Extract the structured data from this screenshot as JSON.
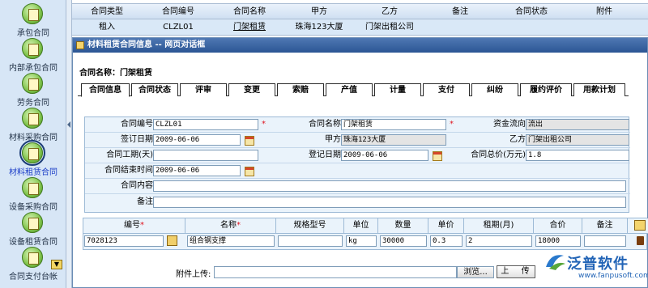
{
  "sidebar": {
    "items": [
      {
        "label": "承包合同"
      },
      {
        "label": "内部承包合同"
      },
      {
        "label": "劳务合同"
      },
      {
        "label": "材料采购合同"
      },
      {
        "label": "材料租赁合同"
      },
      {
        "label": "设备采购合同"
      },
      {
        "label": "设备租赁合同"
      },
      {
        "label": "合同支付台帐"
      }
    ],
    "active_index": 4
  },
  "list": {
    "columns": [
      "合同类型",
      "合同编号",
      "合同名称",
      "甲方",
      "乙方",
      "备注",
      "合同状态",
      "附件"
    ],
    "rows": [
      {
        "type": "租入",
        "number": "CLZL01",
        "name": "门架租赁",
        "party_a": "珠海123大厦",
        "party_b": "门架出租公司",
        "remark": "",
        "status": "",
        "attachment": ""
      }
    ]
  },
  "dialog": {
    "title": "材料租赁合同信息 -- 网页对话框",
    "contract_name_line": "合同名称：门架租赁",
    "tabs": [
      "合同信息",
      "合同状态",
      "评审",
      "变更",
      "索赔",
      "产值",
      "计量",
      "支付",
      "纠纷",
      "履约评价",
      "用款计划"
    ],
    "active_tab": 0,
    "form": {
      "contract_no_label": "合同编号",
      "contract_no": "CLZL01",
      "contract_name_label": "合同名称",
      "contract_name": "门架租赁",
      "fund_flow_label": "资金流向",
      "fund_flow": "流出",
      "sign_date_label": "签订日期",
      "sign_date": "2009-06-06",
      "party_a_label": "甲方",
      "party_a": "珠海123大厦",
      "party_b_label": "乙方",
      "party_b": "门架出租公司",
      "duration_label": "合同工期(天)",
      "duration": "",
      "register_date_label": "登记日期",
      "register_date": "2009-06-06",
      "total_price_label": "合同总价(万元)",
      "total_price": "1.8",
      "end_date_label": "合同结束时间",
      "end_date": "2009-06-06",
      "content_label": "合同内容",
      "content": "",
      "remark_label": "备注",
      "remark": "",
      "required_mark": "*"
    },
    "items": {
      "columns": [
        "编号",
        "名称",
        "规格型号",
        "单位",
        "数量",
        "单价",
        "租期(月)",
        "合价",
        "备注"
      ],
      "required_columns": [
        0,
        1
      ],
      "rows": [
        {
          "code": "7028123",
          "name": "组合钢支撑",
          "spec": "",
          "unit": "kg",
          "qty": "30000",
          "price": "0.3",
          "term": "2",
          "total": "18000",
          "remark": ""
        }
      ]
    },
    "upload": {
      "label": "附件上传:",
      "browse": "浏览...",
      "upload": "上 传"
    }
  },
  "logo": {
    "brand": "泛普软件",
    "url": "www.fanpusoft.com"
  },
  "colors": {
    "sidebar_bg": "#d7e6f6",
    "dialog_title_bg": "#2b5594",
    "required": "#e0141e",
    "brand": "#2264b6"
  }
}
